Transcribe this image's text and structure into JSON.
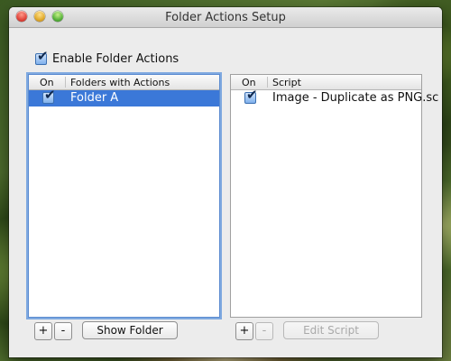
{
  "window": {
    "title": "Folder Actions Setup"
  },
  "enable": {
    "label": "Enable Folder Actions",
    "checked": true
  },
  "folders_table": {
    "headers": {
      "on": "On",
      "name": "Folders with Actions"
    },
    "rows": [
      {
        "on": true,
        "name": "Folder A",
        "selected": true
      }
    ]
  },
  "scripts_table": {
    "headers": {
      "on": "On",
      "name": "Script"
    },
    "rows": [
      {
        "on": true,
        "name": "Image - Duplicate as PNG.sc"
      }
    ]
  },
  "buttons": {
    "add_folder": "+",
    "remove_folder": "-",
    "show_folder": "Show Folder",
    "add_script": "+",
    "remove_script": "-",
    "edit_script": "Edit Script"
  },
  "icons": {
    "check": "✔"
  }
}
